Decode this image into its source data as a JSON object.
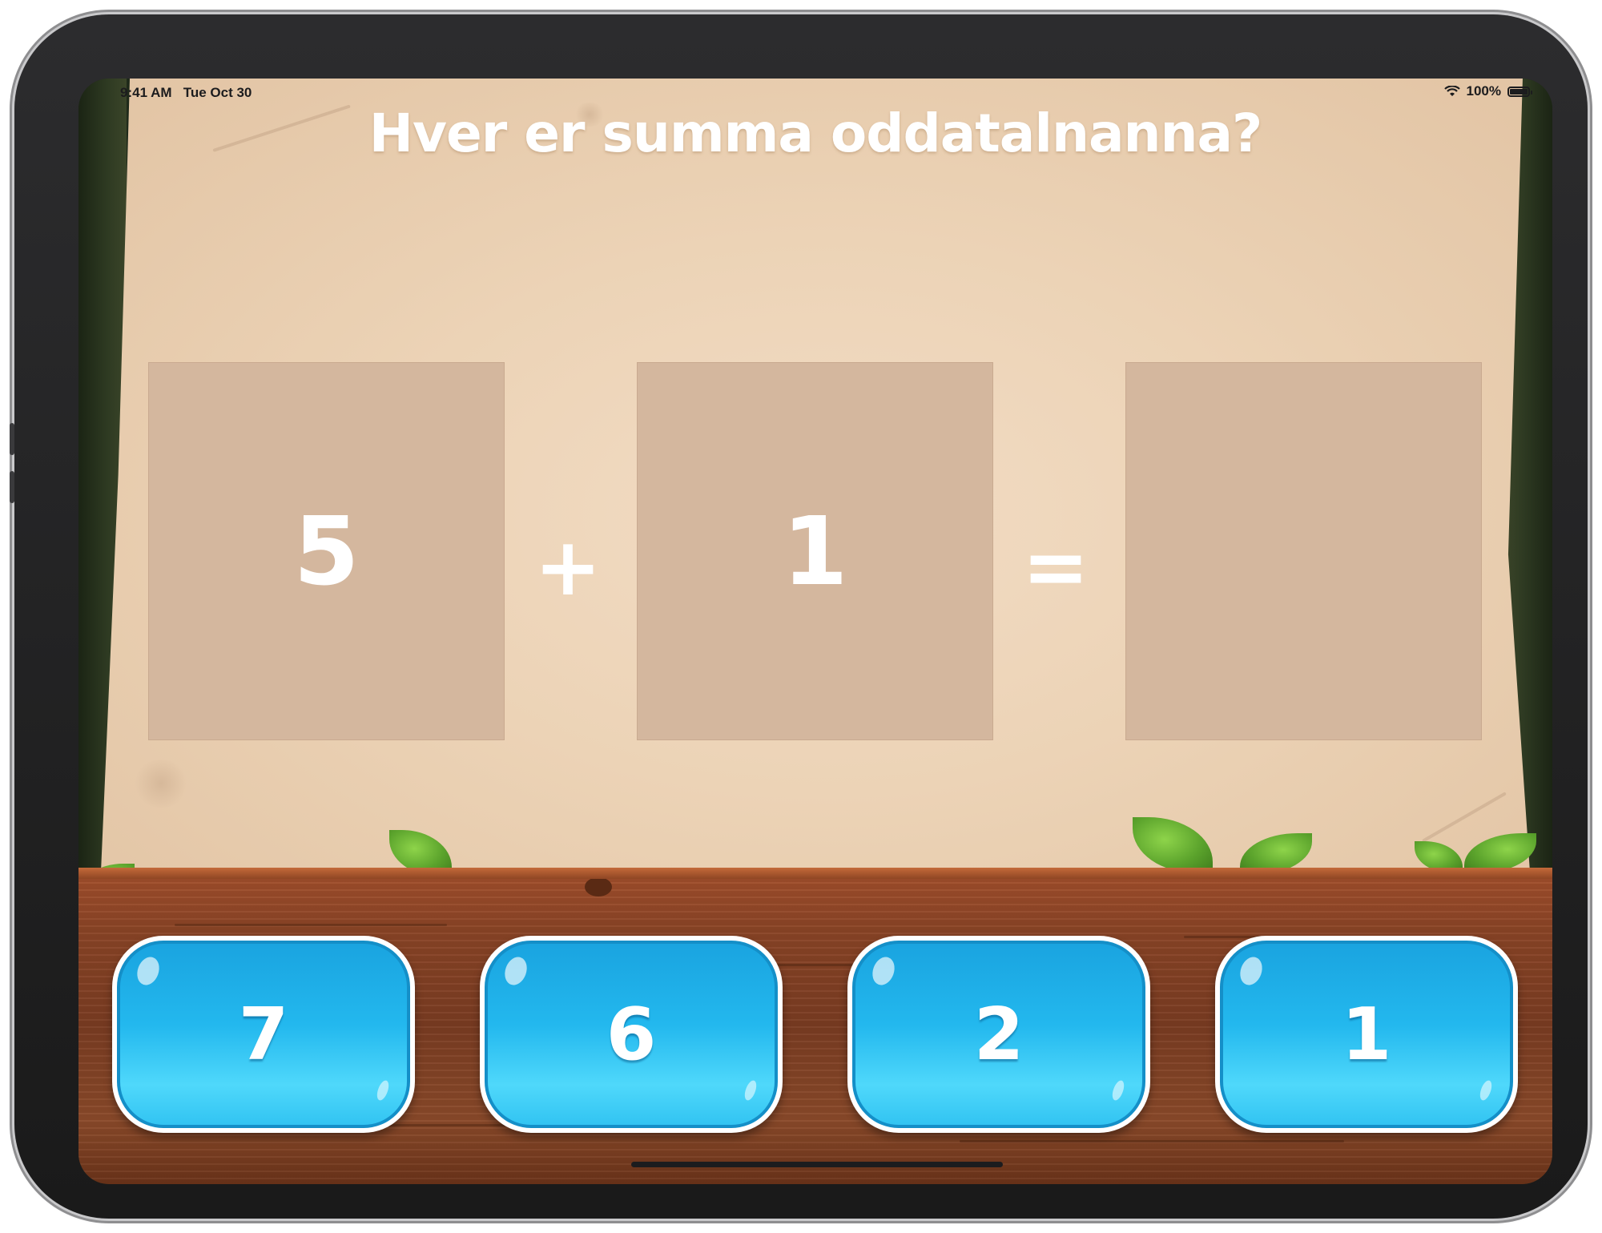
{
  "status_bar": {
    "time": "9:41 AM",
    "date": "Tue Oct 30",
    "battery": "100%",
    "wifi_icon": "wifi-icon",
    "battery_icon": "battery-icon"
  },
  "question": "Hver er summa oddatalnanna?",
  "equation": {
    "left": "5",
    "operator": "+",
    "right": "1",
    "equals": "=",
    "result": ""
  },
  "answers": [
    {
      "label": "7"
    },
    {
      "label": "6"
    },
    {
      "label": "2"
    },
    {
      "label": "1"
    }
  ],
  "colors": {
    "parchment": "#ecd3b6",
    "box": "#d4b79e",
    "button": "#23b8ee",
    "wood": "#8a4426"
  }
}
